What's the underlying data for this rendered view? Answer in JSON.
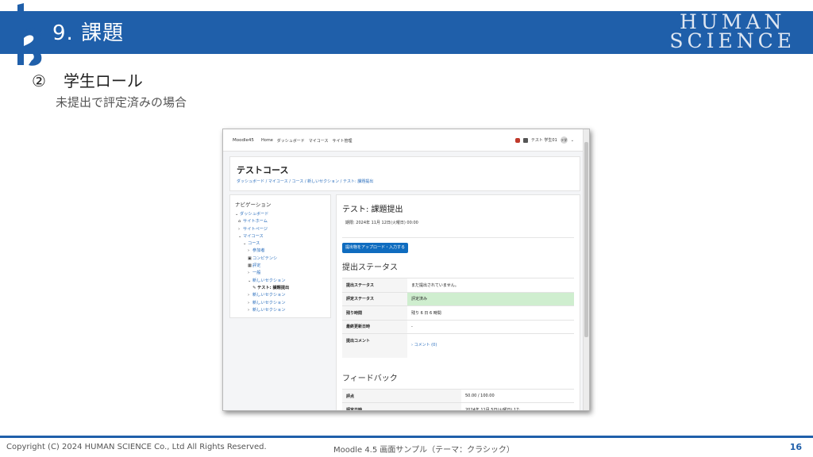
{
  "slide": {
    "title": "9.  課題",
    "brand_line1": "HUMAN",
    "brand_line2": "SCIENCE",
    "sub_number": "②",
    "subheading": "学生ロール",
    "subcaption": "未提出で評定済みの場合",
    "colors": {
      "header": "#1f5faa",
      "footer_line": "#1f5faa"
    }
  },
  "screenshot": {
    "navbar": {
      "brand": "Moodle45",
      "items": [
        "Home",
        "ダッシュボード",
        "マイコース",
        "サイト管理"
      ],
      "user_name": "テスト 学生01",
      "avatar_initials": "テ学",
      "user_menu_caret": "⌄"
    },
    "course": {
      "title": "テストコース",
      "breadcrumb": "ダッシュボード / マイコース / コース / 新しいセクション / テスト: 課題提出"
    },
    "navigation": {
      "title": "ナビゲーション",
      "items": [
        {
          "mark": "⌄",
          "label": "ダッシュボード"
        },
        {
          "mark": "⌂",
          "label": "サイトホーム"
        },
        {
          "mark": "›",
          "label": "サイトページ"
        },
        {
          "mark": "⌄",
          "label": "マイコース"
        },
        {
          "mark": "⌄",
          "label": "コース"
        },
        {
          "mark": "›",
          "label": "参加者"
        },
        {
          "mark": "▣",
          "label": "コンピテンシ"
        },
        {
          "mark": "▦",
          "label": "評定"
        },
        {
          "mark": "›",
          "label": "一般"
        },
        {
          "mark": "⌄",
          "label": "新しいセクション"
        },
        {
          "mark": "✎",
          "label": "テスト: 課題提出"
        },
        {
          "mark": "›",
          "label": "新しいセクション"
        },
        {
          "mark": "›",
          "label": "新しいセクション"
        },
        {
          "mark": "›",
          "label": "新しいセクション"
        }
      ]
    },
    "assignment": {
      "title": "テスト: 課題提出",
      "deadline": "期限: 2024年 11月 12日(火曜日) 00:00",
      "upload_button": "提出物をアップロード・入力する",
      "status_heading": "提出ステータス",
      "status_rows": [
        {
          "key": "提出ステータス",
          "value": "まだ提出されていません。"
        },
        {
          "key": "評定ステータス",
          "value": "評定済み"
        },
        {
          "key": "残り時間",
          "value": "残り 6 日 6 時間"
        },
        {
          "key": "最終更新日時",
          "value": "-"
        },
        {
          "key": "提出コメント",
          "value": "コメント (0)"
        }
      ],
      "comment_chevron": "›",
      "feedback_heading": "フィードバック",
      "feedback_rows": [
        {
          "key": "評点",
          "value": "50.00 / 100.00"
        },
        {
          "key": "評定日時",
          "value": "2024年 11月 5日(火曜日) 17:..."
        }
      ]
    }
  },
  "footer": {
    "copyright": "Copyright (C) 2024 HUMAN SCIENCE Co., Ltd All Rights Reserved.",
    "center": "Moodle 4.5 画面サンプル（テーマ：クラシック）",
    "page": "16"
  }
}
